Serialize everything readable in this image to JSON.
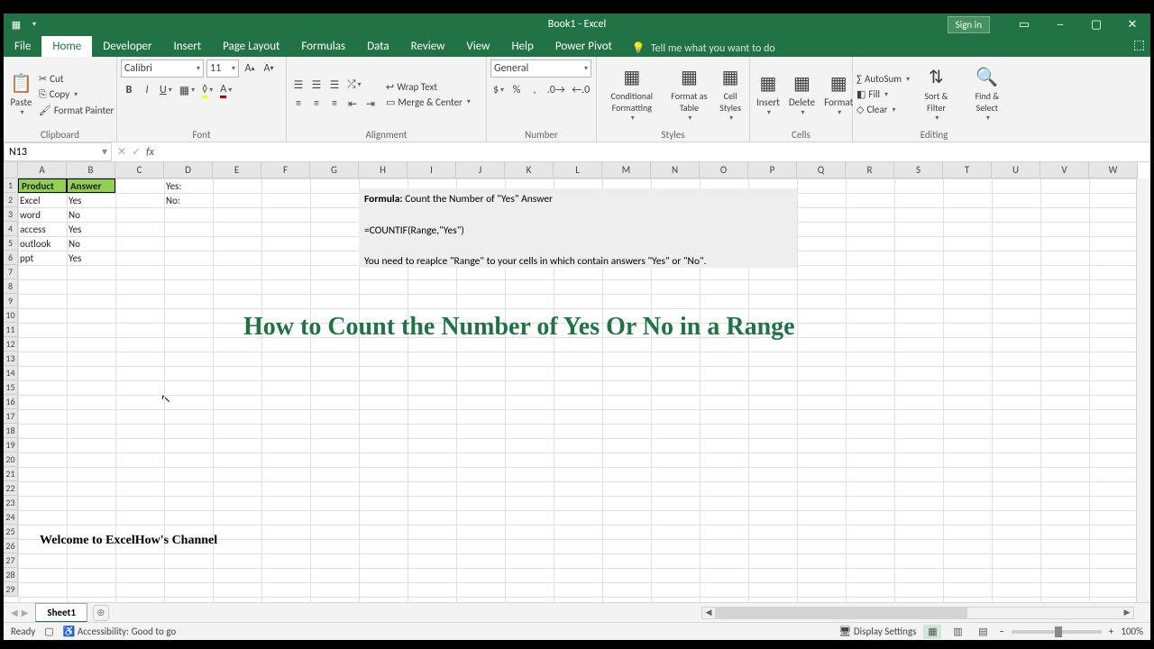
{
  "titlebar": {
    "title": "Book1 - Excel",
    "signin": "Sign in"
  },
  "menu": {
    "file": "File",
    "home": "Home",
    "developer": "Developer",
    "insert": "Insert",
    "page_layout": "Page Layout",
    "formulas": "Formulas",
    "data": "Data",
    "review": "Review",
    "view": "View",
    "help": "Help",
    "powerpivot": "Power Pivot",
    "search_placeholder": "Tell me what you want to do"
  },
  "ribbon": {
    "clipboard": {
      "paste": "Paste",
      "cut": "Cut",
      "copy": "Copy",
      "painter": "Format Painter",
      "label": "Clipboard"
    },
    "font": {
      "name": "Calibri",
      "size": "11",
      "label": "Font"
    },
    "alignment": {
      "wrap": "Wrap Text",
      "merge": "Merge & Center",
      "label": "Alignment"
    },
    "number": {
      "format": "General",
      "label": "Number"
    },
    "styles": {
      "cond": "Conditional Formatting",
      "table": "Format as Table",
      "cell": "Cell Styles",
      "label": "Styles"
    },
    "cells": {
      "insert": "Insert",
      "delete": "Delete",
      "format": "Format",
      "label": "Cells"
    },
    "editing": {
      "autosum": "AutoSum",
      "fill": "Fill",
      "clear": "Clear",
      "sort": "Sort & Filter",
      "find": "Find & Select",
      "label": "Editing"
    }
  },
  "namebox": "N13",
  "columns": [
    "A",
    "B",
    "C",
    "D",
    "E",
    "F",
    "G",
    "H",
    "I",
    "J",
    "K",
    "L",
    "M",
    "N",
    "O",
    "P",
    "Q",
    "R",
    "S",
    "T",
    "U",
    "V",
    "W"
  ],
  "rows": 29,
  "headers": {
    "product": "Product",
    "answer": "Answer"
  },
  "table_data": [
    {
      "product": "Excel",
      "answer": "Yes"
    },
    {
      "product": "word",
      "answer": "No"
    },
    {
      "product": "access",
      "answer": "Yes"
    },
    {
      "product": "outlook",
      "answer": "No"
    },
    {
      "product": "ppt",
      "answer": "Yes"
    }
  ],
  "labels": {
    "yes": "Yes:",
    "no": "No:"
  },
  "formula_box": {
    "heading": "Formula:",
    "heading_rest": " Count the Number of \"Yes\" Answer",
    "formula": "=COUNTIF(Range,\"Yes\")",
    "note": "You need to reaplce \"Range\" to your cells in which contain answers \"Yes\" or \"No\"."
  },
  "big_title": "How to Count the Number of Yes  Or No in a Range",
  "welcome": "Welcome to ExcelHow's  Channel",
  "sheet": {
    "name": "Sheet1"
  },
  "status": {
    "ready": "Ready",
    "accessibility": "Accessibility: Good to go",
    "display": "Display Settings",
    "zoom": "100%"
  }
}
